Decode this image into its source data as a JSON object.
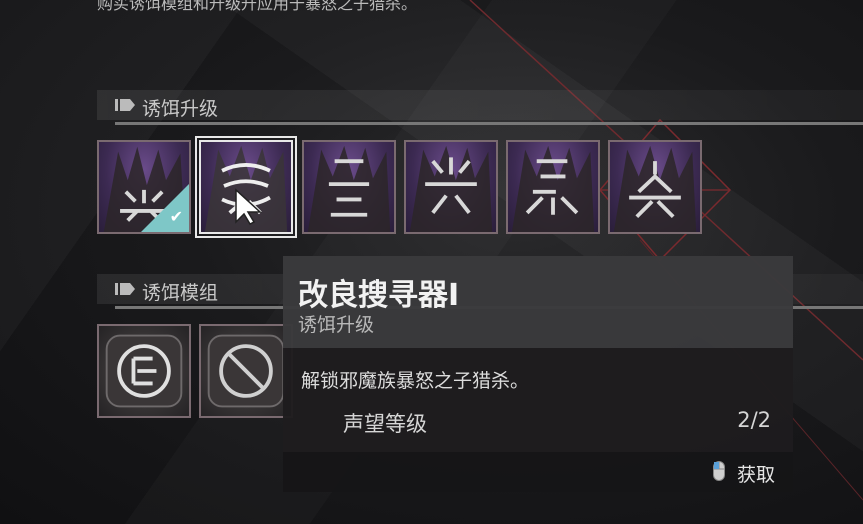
{
  "top_text": "购买诱饵模组和升级升应用于暴怒之子猎杀。",
  "sections": [
    {
      "label": "诱饵升级"
    },
    {
      "label": "诱饵模组"
    }
  ],
  "upgrade_slots": [
    {
      "icon": "glyph-1-icon",
      "owned": true
    },
    {
      "icon": "glyph-2-icon",
      "selected": true
    },
    {
      "icon": "glyph-3-icon"
    },
    {
      "icon": "glyph-4-icon"
    },
    {
      "icon": "glyph-5-icon"
    },
    {
      "icon": "glyph-6-icon"
    }
  ],
  "mod_slots": [
    {
      "icon": "mod-glyph-icon"
    },
    {
      "icon": "mod-blocked-icon"
    }
  ],
  "tooltip": {
    "title": "改良搜寻器I",
    "subtitle": "诱饵升级",
    "description": "解锁邪魔族暴怒之子猎杀。",
    "row_label": "声望等级",
    "row_value": "2/2",
    "action_label": "获取"
  },
  "colors": {
    "accent_check": "#7ec7c7",
    "purple": "#3c2a52",
    "red_line": "#7a2a2e"
  }
}
